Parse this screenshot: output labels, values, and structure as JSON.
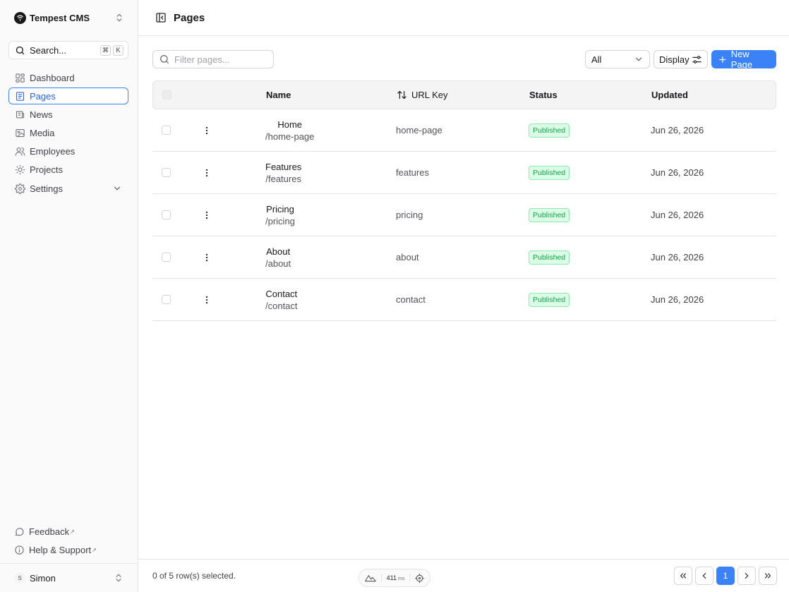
{
  "app": {
    "name": "Tempest CMS"
  },
  "sidebar": {
    "search": {
      "label": "Search...",
      "kbd": [
        "⌘",
        "K"
      ]
    },
    "items": [
      {
        "label": "Dashboard",
        "icon": "dashboard-icon"
      },
      {
        "label": "Pages",
        "icon": "pages-icon",
        "active": true
      },
      {
        "label": "News",
        "icon": "news-icon"
      },
      {
        "label": "Media",
        "icon": "image-icon"
      },
      {
        "label": "Employees",
        "icon": "users-icon"
      },
      {
        "label": "Projects",
        "icon": "sun-icon"
      },
      {
        "label": "Settings",
        "icon": "gear-icon"
      }
    ],
    "footer_links": [
      {
        "label": "Feedback",
        "icon": "chat-icon",
        "external_mark": "↗"
      },
      {
        "label": "Help & Support",
        "icon": "info-icon",
        "external_mark": "↗"
      }
    ],
    "user": {
      "initial": "S",
      "name": "Simon"
    }
  },
  "header": {
    "title": "Pages"
  },
  "toolbar": {
    "filter_placeholder": "Filter pages...",
    "status_select": "All",
    "display_label": "Display",
    "new_label": "New Page"
  },
  "table": {
    "columns": {
      "name": "Name",
      "url_key": "URL Key",
      "status": "Status",
      "updated": "Updated"
    },
    "rows": [
      {
        "name": "Home",
        "path": "/home-page",
        "url_key": "home-page",
        "status": "Published",
        "updated": "Jun 26, 2026"
      },
      {
        "name": "Features",
        "path": "/features",
        "url_key": "features",
        "status": "Published",
        "updated": "Jun 26, 2026"
      },
      {
        "name": "Pricing",
        "path": "/pricing",
        "url_key": "pricing",
        "status": "Published",
        "updated": "Jun 26, 2026"
      },
      {
        "name": "About",
        "path": "/about",
        "url_key": "about",
        "status": "Published",
        "updated": "Jun 26, 2026"
      },
      {
        "name": "Contact",
        "path": "/contact",
        "url_key": "contact",
        "status": "Published",
        "updated": "Jun 26, 2026"
      }
    ]
  },
  "footer": {
    "selection": "0 of 5 row(s) selected.",
    "perf": {
      "value": "411",
      "unit": "ms"
    },
    "current_page": "1"
  },
  "colors": {
    "accent": "#3b82f6",
    "badge_text": "#16a34a",
    "badge_bg": "#dcfce7"
  }
}
